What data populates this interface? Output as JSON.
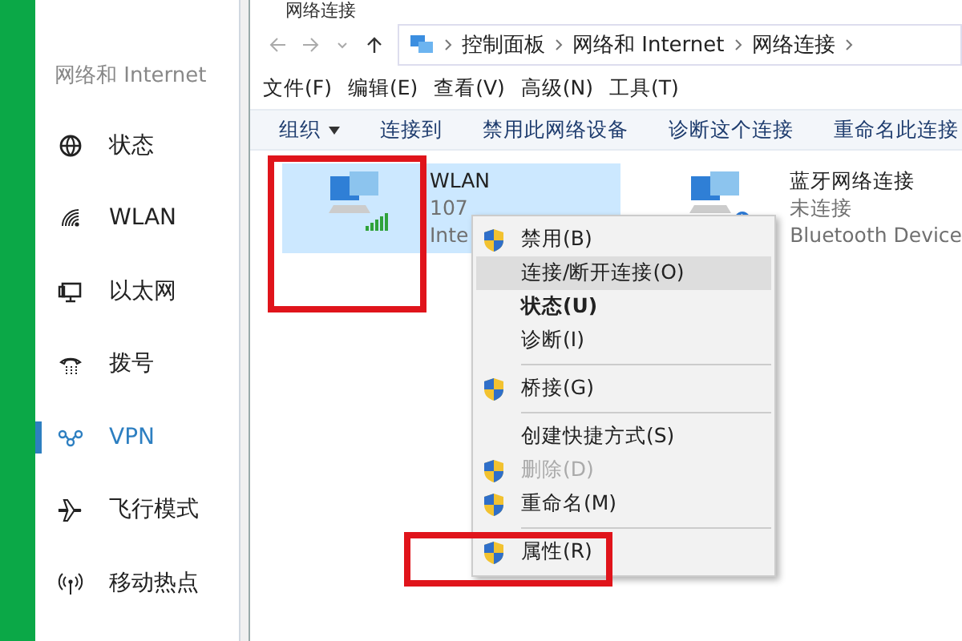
{
  "settings_sidebar": {
    "heading": "网络和 Internet",
    "items": [
      {
        "label": "状态",
        "selected": false
      },
      {
        "label": "WLAN",
        "selected": false
      },
      {
        "label": "以太网",
        "selected": false
      },
      {
        "label": "拨号",
        "selected": false
      },
      {
        "label": "VPN",
        "selected": true
      },
      {
        "label": "飞行模式",
        "selected": false
      },
      {
        "label": "移动热点",
        "selected": false
      }
    ]
  },
  "window": {
    "title": "网络连接",
    "breadcrumb": [
      "控制面板",
      "网络和 Internet",
      "网络连接"
    ],
    "menu": [
      "文件(F)",
      "编辑(E)",
      "查看(V)",
      "高级(N)",
      "工具(T)"
    ],
    "toolbar": [
      {
        "label": "组织",
        "dropdown": true
      },
      {
        "label": "连接到",
        "dropdown": false
      },
      {
        "label": "禁用此网络设备",
        "dropdown": false
      },
      {
        "label": "诊断这个连接",
        "dropdown": false
      },
      {
        "label": "重命名此连接",
        "dropdown": false
      }
    ],
    "connections": [
      {
        "name": "WLAN",
        "lines": [
          "107",
          "Inte"
        ],
        "selected": true
      },
      {
        "name": "蓝牙网络连接",
        "lines": [
          "未连接",
          "Bluetooth Device"
        ],
        "selected": false
      }
    ]
  },
  "context_menu": {
    "items": [
      {
        "kind": "item",
        "label": "禁用(B)",
        "shield": true,
        "disabled": false,
        "bold": false,
        "selected": false
      },
      {
        "kind": "item",
        "label": "连接/断开连接(O)",
        "shield": false,
        "disabled": false,
        "bold": false,
        "selected": true
      },
      {
        "kind": "item",
        "label": "状态(U)",
        "shield": false,
        "disabled": false,
        "bold": true,
        "selected": false
      },
      {
        "kind": "item",
        "label": "诊断(I)",
        "shield": false,
        "disabled": false,
        "bold": false,
        "selected": false
      },
      {
        "kind": "separator"
      },
      {
        "kind": "item",
        "label": "桥接(G)",
        "shield": true,
        "disabled": false,
        "bold": false,
        "selected": false
      },
      {
        "kind": "separator"
      },
      {
        "kind": "item",
        "label": "创建快捷方式(S)",
        "shield": false,
        "disabled": false,
        "bold": false,
        "selected": false
      },
      {
        "kind": "item",
        "label": "删除(D)",
        "shield": true,
        "disabled": true,
        "bold": false,
        "selected": false
      },
      {
        "kind": "item",
        "label": "重命名(M)",
        "shield": true,
        "disabled": false,
        "bold": false,
        "selected": false
      },
      {
        "kind": "separator"
      },
      {
        "kind": "item",
        "label": "属性(R)",
        "shield": true,
        "disabled": false,
        "bold": false,
        "selected": false
      }
    ]
  }
}
